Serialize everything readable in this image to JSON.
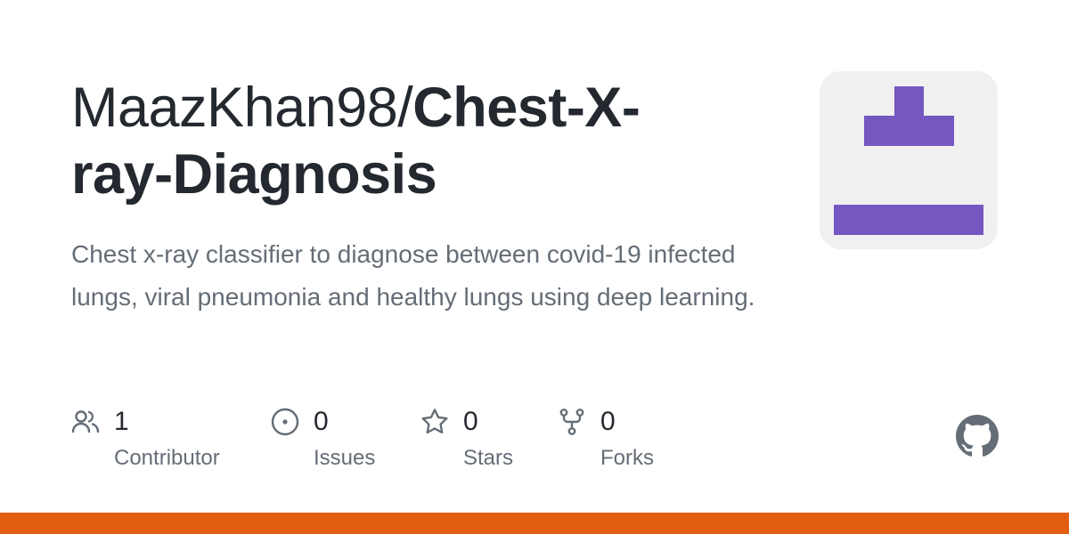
{
  "repo": {
    "owner": "MaazKhan98/",
    "name": "Chest-X-ray-Diagnosis",
    "description": "Chest x-ray classifier to diagnose between covid-19 infected lungs, viral pneumonia and healthy lungs using deep learning."
  },
  "stats": [
    {
      "icon": "people-icon",
      "count": "1",
      "label": "Contributor"
    },
    {
      "icon": "issue-icon",
      "count": "0",
      "label": "Issues"
    },
    {
      "icon": "star-icon",
      "count": "0",
      "label": "Stars"
    },
    {
      "icon": "fork-icon",
      "count": "0",
      "label": "Forks"
    }
  ],
  "colors": {
    "accent_bar": "#e05d11",
    "avatar_purple": "#7557c2",
    "avatar_bg": "#f0f0f0",
    "text_primary": "#24292f",
    "text_secondary": "#656d76"
  },
  "icons": {
    "avatar": "identicon",
    "brand": "github-mark-icon"
  }
}
